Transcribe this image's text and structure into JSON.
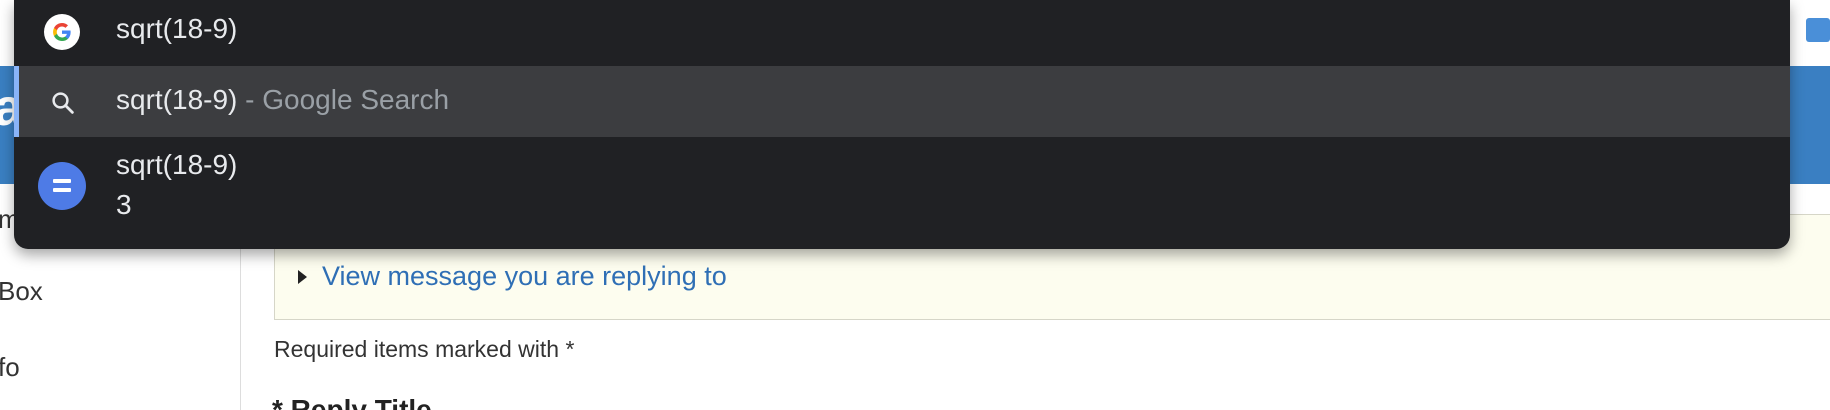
{
  "omnibox": {
    "input_value": "sqrt(18-9)",
    "suggestions": [
      {
        "icon": "search-icon",
        "text": "sqrt(18-9)",
        "suffix": " - Google Search",
        "selected": true
      },
      {
        "icon": "calculator-icon",
        "query": "sqrt(18-9)",
        "result": "3"
      }
    ]
  },
  "page": {
    "header_partial_text": "a",
    "sidebar": {
      "items": [
        "m",
        "Box",
        "fo"
      ]
    },
    "reply_link": "View message you are replying to",
    "required_note": "Required items marked with *",
    "reply_title": "* Reply Title"
  },
  "colors": {
    "omnibox_bg": "#202124",
    "selected_row_bg": "#3c3d40",
    "accent": "#8ab4f8",
    "calc_icon": "#4e7be6",
    "header_blue": "#3a7fc2",
    "link": "#2f6fb5"
  }
}
